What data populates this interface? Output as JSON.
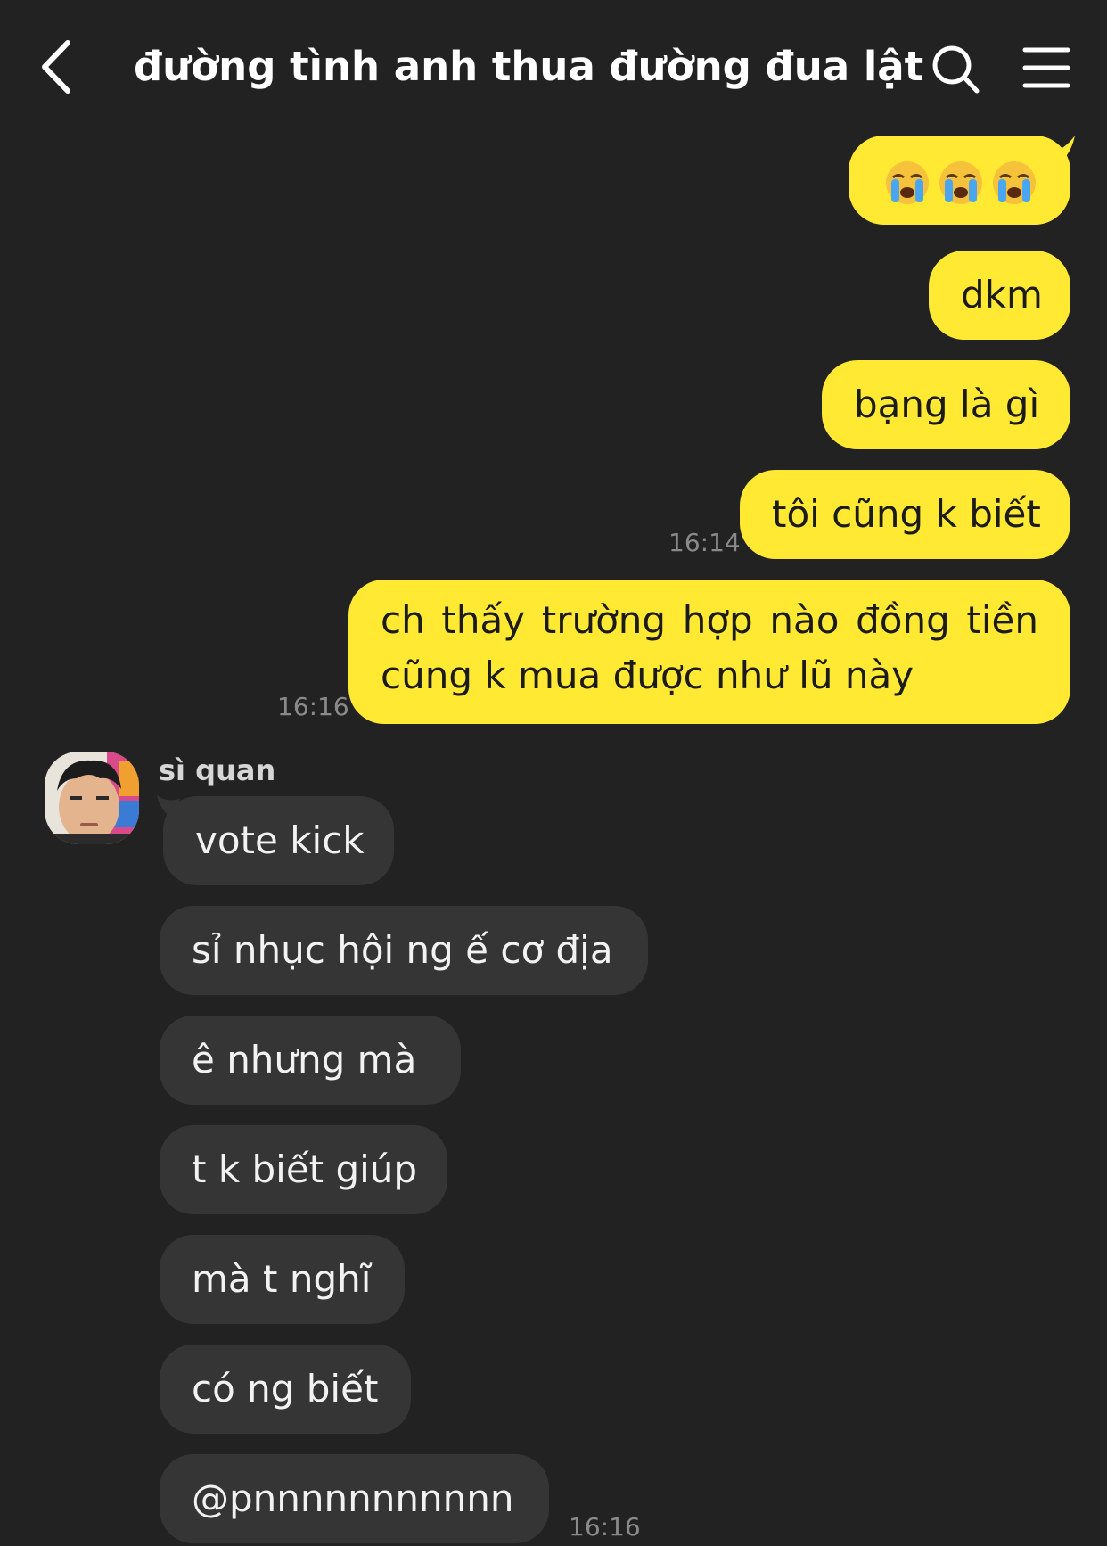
{
  "header": {
    "title": "đường tình anh thua đường đua lật bá",
    "back_icon": "chevron-left-icon",
    "search_icon": "search-icon",
    "menu_icon": "menu-icon"
  },
  "colors": {
    "background": "#222222",
    "outgoing_bubble": "#ffe933",
    "incoming_bubble": "#353535",
    "timestamp": "#8a8a8a"
  },
  "messages": {
    "out_1_emoji": "loudly-crying-face-emoji",
    "out_2": "dkm",
    "out_3": "bạng là gì",
    "out_4": "tôi cũng k biết",
    "out_4_time": "16:14",
    "out_5_line1": "ch thấy trường hợp nào đồng tiền",
    "out_5_line2": "cũng k mua được như lũ này",
    "out_5_time": "16:16"
  },
  "incoming": {
    "sender": "sì quan",
    "items": [
      "vote kick",
      "sỉ nhục hội ng ế cơ địa",
      "ê nhưng mà",
      "t k biết giúp",
      "mà t nghĩ",
      "có ng biết",
      "@pnnnnnnnnnnn"
    ],
    "last_time": "16:16"
  }
}
